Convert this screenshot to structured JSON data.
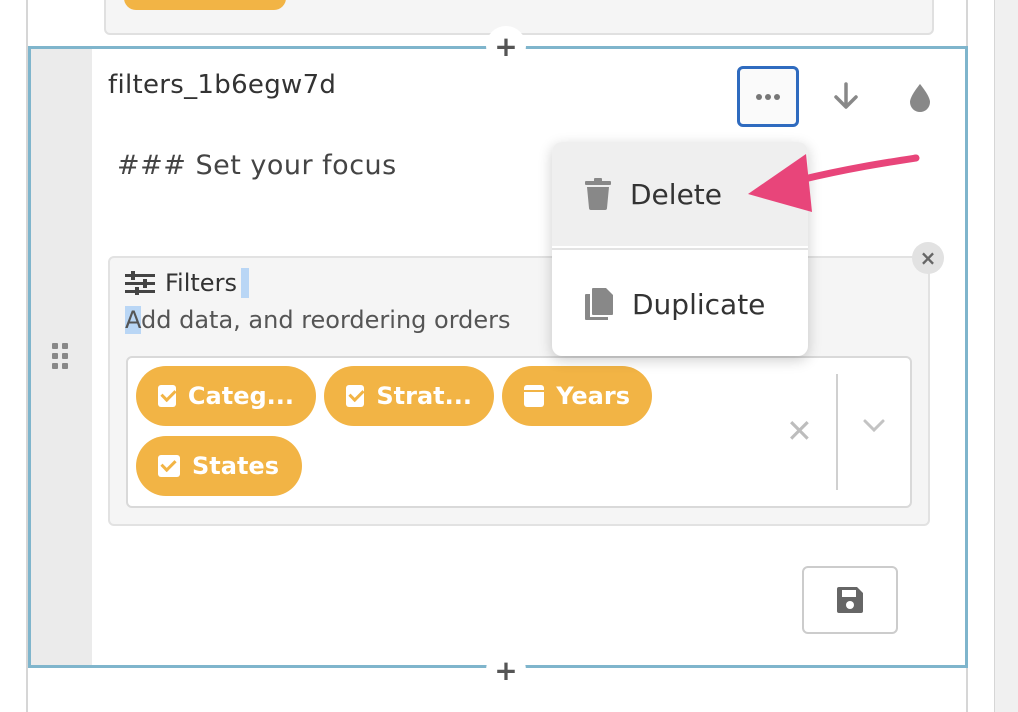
{
  "cell": {
    "id": "filters_1b6egw7d",
    "markdown": "### Set your focus"
  },
  "toolbar": {
    "more_icon": "more-horizontal-icon",
    "move_down_icon": "arrow-down-icon",
    "style_icon": "droplet-icon"
  },
  "menu": {
    "items": [
      {
        "label": "Delete",
        "icon": "trash-icon"
      },
      {
        "label": "Duplicate",
        "icon": "copy-icon"
      }
    ]
  },
  "filters": {
    "title": "Filters",
    "description_first": "A",
    "description_rest": "dd data, and reordering orders",
    "chips": [
      {
        "label": "Categ...",
        "icon": "checkbox-icon"
      },
      {
        "label": "Strat...",
        "icon": "checkbox-icon"
      },
      {
        "label": "Years",
        "icon": "calendar-icon"
      },
      {
        "label": "States",
        "icon": "checkbox-icon"
      }
    ]
  },
  "colors": {
    "chip": "#f2b445",
    "selection_border": "#7fb5cc",
    "focus_border": "#2f6bbf",
    "arrow": "#e8457a"
  }
}
